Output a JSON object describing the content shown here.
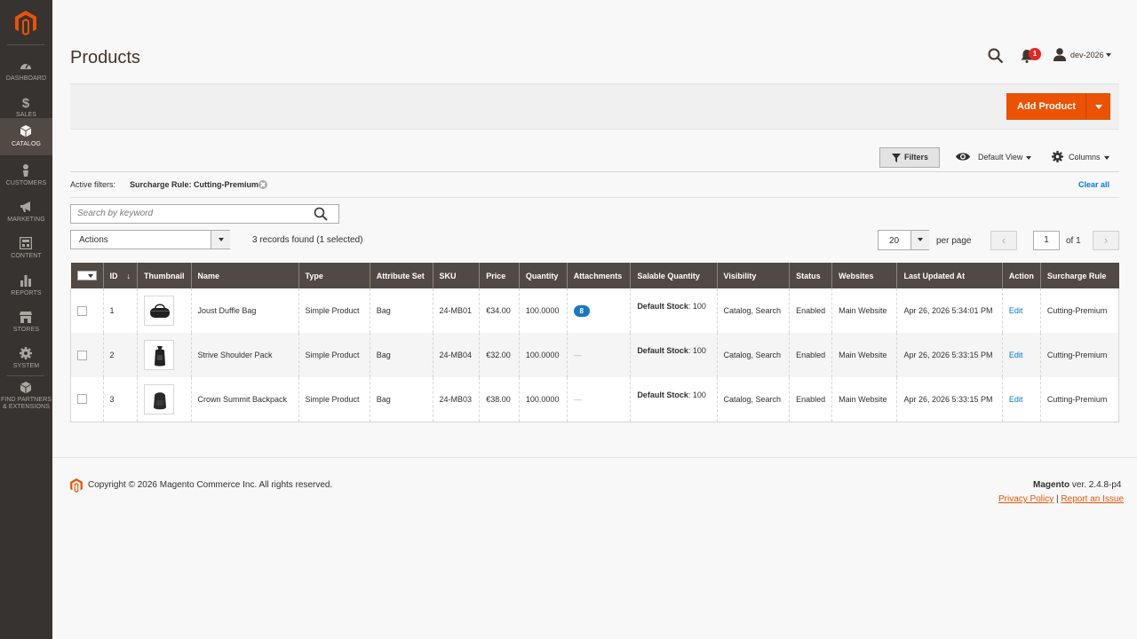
{
  "sidebar": {
    "items": [
      {
        "label": "DASHBOARD",
        "icon": "dashboard-icon"
      },
      {
        "label": "SALES",
        "icon": "dollar-icon"
      },
      {
        "label": "CATALOG",
        "icon": "box-icon",
        "active": true
      },
      {
        "label": "CUSTOMERS",
        "icon": "person-icon"
      },
      {
        "label": "MARKETING",
        "icon": "megaphone-icon"
      },
      {
        "label": "CONTENT",
        "icon": "layout-icon"
      },
      {
        "label": "REPORTS",
        "icon": "bar-chart-icon"
      },
      {
        "label": "STORES",
        "icon": "store-icon"
      },
      {
        "label": "SYSTEM",
        "icon": "gear-icon"
      },
      {
        "label": "FIND PARTNERS & EXTENSIONS",
        "icon": "cube-icon"
      }
    ]
  },
  "header": {
    "title": "Products",
    "notification_count": "1",
    "username": "dev-2026"
  },
  "action_bar": {
    "add_product_label": "Add Product"
  },
  "toolbar": {
    "filters_label": "Filters",
    "view_label": "Default View",
    "columns_label": "Columns"
  },
  "active_filters": {
    "label": "Active filters:",
    "value": "Surcharge Rule: Cutting-Premium",
    "clear_all": "Clear all"
  },
  "search": {
    "placeholder": "Search by keyword"
  },
  "mass_actions": {
    "selected": "Actions",
    "records_found": "3 records found (1 selected)"
  },
  "pager": {
    "per_page_value": "20",
    "per_page_label": "per page",
    "current_page": "1",
    "of_label": "of 1",
    "prev": "‹",
    "next": "›"
  },
  "grid": {
    "columns": [
      "ID",
      "Thumbnail",
      "Name",
      "Type",
      "Attribute Set",
      "SKU",
      "Price",
      "Quantity",
      "Attachments",
      "Salable Quantity",
      "Visibility",
      "Status",
      "Websites",
      "Last Updated At",
      "Action",
      "Surcharge Rule"
    ],
    "sort_arrow": "↓",
    "rows": [
      {
        "id": "1",
        "name": "Joust Duffle Bag",
        "type": "Simple Product",
        "attribute_set": "Bag",
        "sku": "24-MB01",
        "price": "€34.00",
        "quantity": "100.0000",
        "attachments": "8",
        "stock_name": "Default Stock",
        "stock_qty": ": 100",
        "visibility": "Catalog, Search",
        "status": "Enabled",
        "websites": "Main Website",
        "updated": "Apr 26, 2026 5:34:01 PM",
        "action": "Edit",
        "surcharge": "Cutting-Premium"
      },
      {
        "id": "2",
        "name": "Strive Shoulder Pack",
        "type": "Simple Product",
        "attribute_set": "Bag",
        "sku": "24-MB04",
        "price": "€32.00",
        "quantity": "100.0000",
        "attachments": "—",
        "stock_name": "Default Stock",
        "stock_qty": ": 100",
        "visibility": "Catalog, Search",
        "status": "Enabled",
        "websites": "Main Website",
        "updated": "Apr 26, 2026 5:33:15 PM",
        "action": "Edit",
        "surcharge": "Cutting-Premium"
      },
      {
        "id": "3",
        "name": "Crown Summit Backpack",
        "type": "Simple Product",
        "attribute_set": "Bag",
        "sku": "24-MB03",
        "price": "€38.00",
        "quantity": "100.0000",
        "attachments": "—",
        "stock_name": "Default Stock",
        "stock_qty": ": 100",
        "visibility": "Catalog, Search",
        "status": "Enabled",
        "websites": "Main Website",
        "updated": "Apr 26, 2026 5:33:15 PM",
        "action": "Edit",
        "surcharge": "Cutting-Premium"
      }
    ]
  },
  "footer": {
    "copyright": "Copyright © 2026 Magento Commerce Inc. All rights reserved.",
    "brand": "Magento",
    "version": " ver. 2.4.8-p4",
    "privacy": "Privacy Policy",
    "separator": "|",
    "report": "Report an Issue"
  },
  "colors": {
    "sidebar_bg": "#373330",
    "accent": "#eb5202",
    "grid_header": "#514943",
    "link": "#007bdb",
    "badge": "#1979c3"
  }
}
